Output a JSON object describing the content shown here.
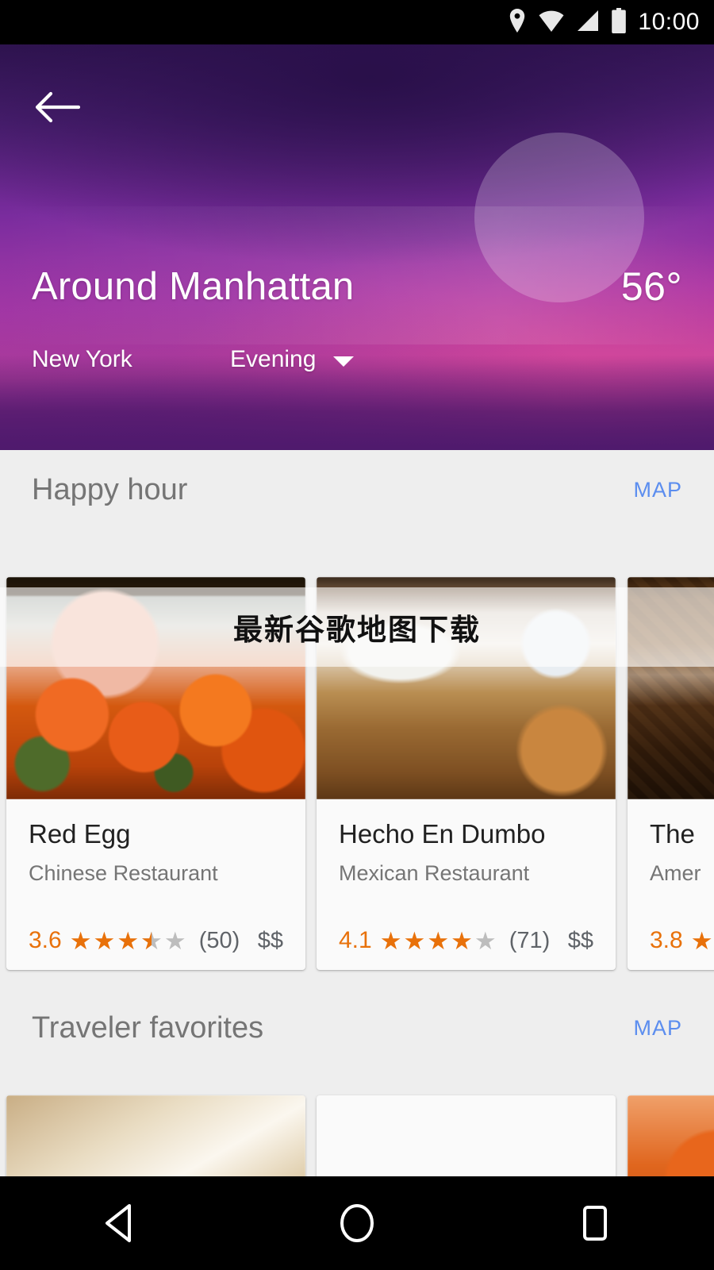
{
  "statusbar": {
    "time": "10:00",
    "icons": [
      "location-pin-icon",
      "wifi-icon",
      "signal-icon",
      "battery-icon"
    ]
  },
  "hero": {
    "back_label": "back-arrow",
    "title": "Around Manhattan",
    "temperature": "56°",
    "city": "New York",
    "time_of_day": "Evening",
    "time_of_day_options": [
      "Evening"
    ],
    "colors": {
      "gradient_top": "#2f1450",
      "gradient_mid": "#a83aa8",
      "gradient_pink": "#c1459f",
      "gradient_bottom": "#4f1a6d",
      "sun_circle": "rgba(255,255,255,0.22)"
    }
  },
  "watermark": {
    "text": "最新谷歌地图下载"
  },
  "sections": [
    {
      "title": "Happy hour",
      "map_label": "MAP",
      "cards": [
        {
          "name": "Red Egg",
          "category": "Chinese Restaurant",
          "rating": "3.6",
          "stars": [
            "full",
            "full",
            "full",
            "half",
            "empty"
          ],
          "reviews": "(50)",
          "price": "$$",
          "image": "img-redegg"
        },
        {
          "name": "Hecho En Dumbo",
          "category": "Mexican Restaurant",
          "rating": "4.1",
          "stars": [
            "full",
            "full",
            "full",
            "full",
            "empty"
          ],
          "reviews": "(71)",
          "price": "$$",
          "image": "img-hecho"
        },
        {
          "name": "The",
          "category": "Amer",
          "rating": "3.8",
          "stars": [
            "full",
            "empty",
            "empty",
            "empty",
            "empty"
          ],
          "reviews": "",
          "price": "",
          "image": "img-the"
        }
      ]
    },
    {
      "title": "Traveler favorites",
      "map_label": "MAP",
      "cards": [
        {
          "name": "",
          "category": "",
          "rating": "",
          "stars": [],
          "reviews": "",
          "price": "",
          "image": "img-fav1"
        },
        {
          "name": "",
          "category": "",
          "rating": "",
          "stars": [],
          "reviews": "",
          "price": "",
          "image": "img-fav2"
        },
        {
          "name": "",
          "category": "",
          "rating": "",
          "stars": [],
          "reviews": "",
          "price": "",
          "image": "img-fav3"
        }
      ]
    }
  ],
  "navbar": {
    "back": "back-nav-button",
    "home": "home-nav-button",
    "recents": "recents-nav-button"
  },
  "theme": {
    "background": "#eeeeee",
    "card_background": "#fafafa",
    "section_title_color": "#757575",
    "map_link_color": "#5b8def",
    "rating_color": "#e8710a",
    "star_empty_color": "#bdbdbd",
    "primary_text": "#212121",
    "secondary_text": "#757575"
  }
}
